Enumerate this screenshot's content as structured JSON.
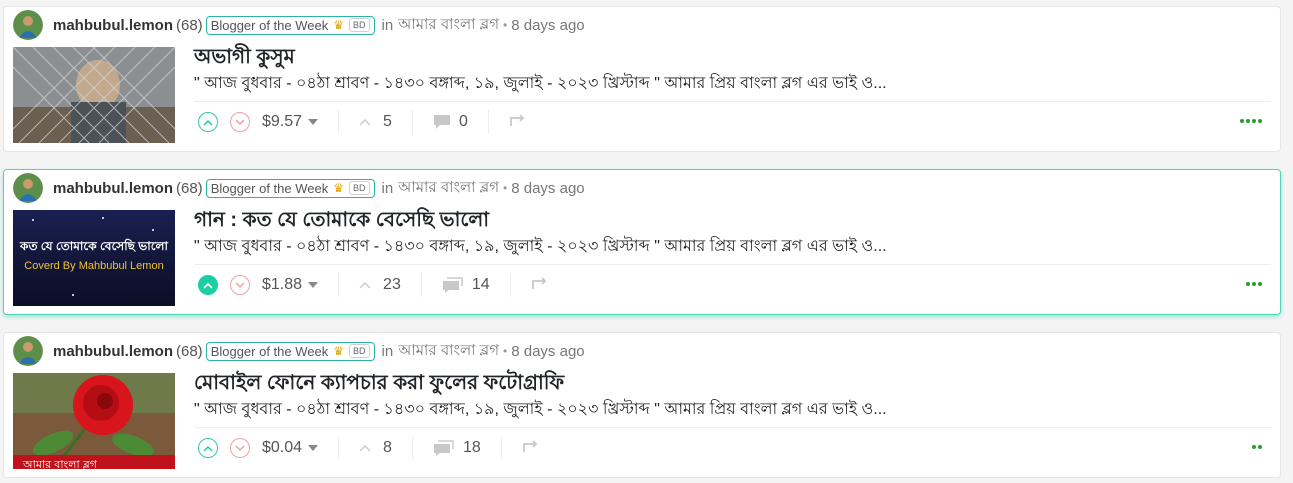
{
  "posts": [
    {
      "author": "mahbubul.lemon",
      "reputation": "(68)",
      "badge": "Blogger of the Week",
      "badge_flag": "BD",
      "in_label": "in",
      "community": "আমার বাংলা ব্লগ",
      "separator": "•",
      "time_ago": "8 days ago",
      "title": "অভাগী কুসুম",
      "excerpt": "\" আজ বুধবার - ০৪ঠা শ্রাবণ - ১৪৩০ বঙ্গাব্দ, ১৯, জুলাই - ২০২৩ খ্রিস্টাব্দ \" আমার প্রিয় বাংলা ব্লগ এর ভাই ও...",
      "payout": "$9.57",
      "votes": "5",
      "comments": "0",
      "upvoted": false,
      "thumbnail_caption": ""
    },
    {
      "author": "mahbubul.lemon",
      "reputation": "(68)",
      "badge": "Blogger of the Week",
      "badge_flag": "BD",
      "in_label": "in",
      "community": "আমার বাংলা ব্লগ",
      "separator": "•",
      "time_ago": "8 days ago",
      "title": "গান : কত যে তোমাকে বেসেছি ভালো",
      "excerpt": "\" আজ বুধবার - ০৪ঠা শ্রাবণ - ১৪৩০ বঙ্গাব্দ, ১৯, জুলাই - ২০২৩ খ্রিস্টাব্দ \" আমার প্রিয় বাংলা ব্লগ এর ভাই ও...",
      "payout": "$1.88",
      "votes": "23",
      "comments": "14",
      "upvoted": true,
      "thumbnail_caption": "কত যে তোমাকে বেসেছি ভালো",
      "thumbnail_subcaption": "Coverd By Mahbubul Lemon"
    },
    {
      "author": "mahbubul.lemon",
      "reputation": "(68)",
      "badge": "Blogger of the Week",
      "badge_flag": "BD",
      "in_label": "in",
      "community": "আমার বাংলা ব্লগ",
      "separator": "•",
      "time_ago": "8 days ago",
      "title": "মোবাইল ফোনে ক্যাপচার করা ফুলের ফটোগ্রাফি",
      "excerpt": "\" আজ বুধবার - ০৪ঠা শ্রাবণ - ১৪৩০ বঙ্গাব্দ, ১৯, জুলাই - ২০২৩ খ্রিস্টাব্দ \" আমার প্রিয় বাংলা ব্লগ এর ভাই ও...",
      "payout": "$0.04",
      "votes": "8",
      "comments": "18",
      "upvoted": false,
      "thumbnail_caption": "আমার বাংলা ব্লগ"
    }
  ],
  "colors": {
    "accent": "#1ccfa3",
    "downvote": "#f0a0a0",
    "badge_border": "#2bb3a6",
    "menu_dots": "#2a9d2a"
  },
  "icons": {
    "upvote": "chevron-up-icon",
    "downvote": "chevron-down-icon",
    "votes": "caret-up-icon",
    "comments": "comment-icon",
    "reblog": "reblog-icon",
    "menu": "more-dots-icon"
  }
}
